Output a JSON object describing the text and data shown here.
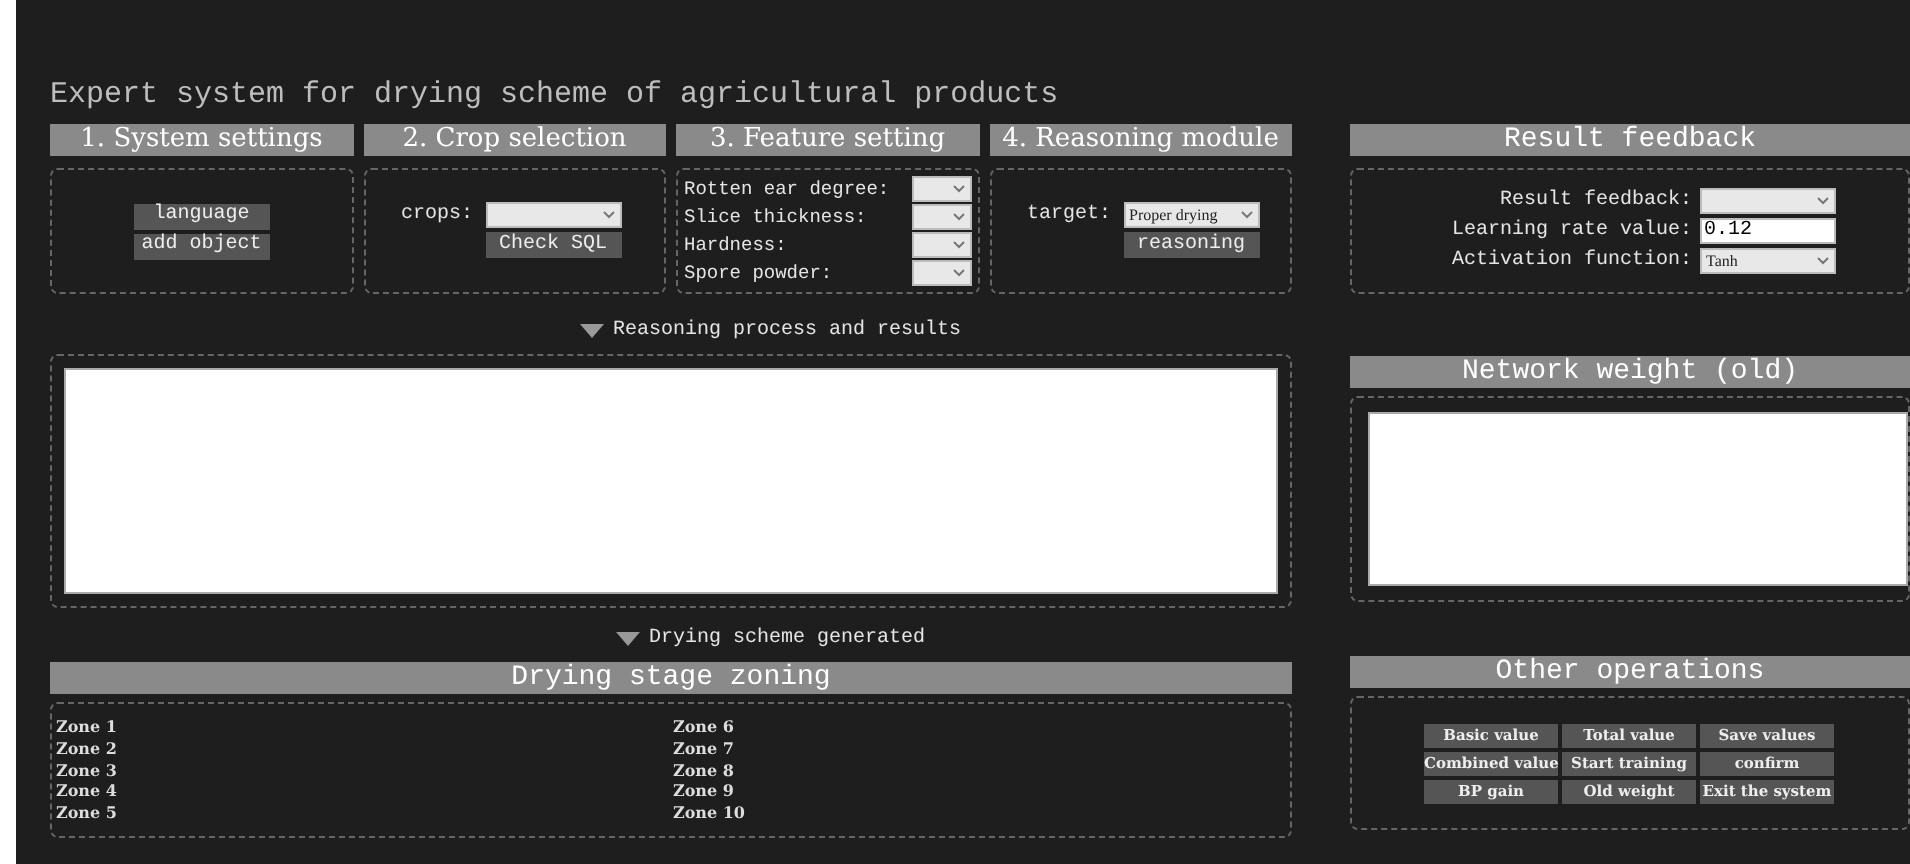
{
  "title": "Expert system for drying scheme of agricultural products",
  "modules": [
    {
      "heading": "1. System settings",
      "kind": "buttons",
      "buttons": [
        "language",
        "add object"
      ]
    },
    {
      "heading": "2. Crop selection",
      "kind": "crop",
      "label": "crops:",
      "button": "Check SQL"
    },
    {
      "heading": "3. Feature setting",
      "kind": "features",
      "fields": [
        {
          "label": "Rotten ear degree:"
        },
        {
          "label": "Slice thickness:"
        },
        {
          "label": "Hardness:"
        },
        {
          "label": "Spore powder:"
        }
      ]
    },
    {
      "heading": "4. Reasoning module",
      "kind": "crop",
      "label": "target:",
      "select": "Proper drying",
      "button": "reasoning"
    }
  ],
  "reasoning_toggle": {
    "label": "Reasoning process and results",
    "expanded": true
  },
  "scheme_toggle": {
    "label": "Drying scheme generated",
    "expanded": true
  },
  "zoning": {
    "heading": "Drying stage zoning",
    "zones": [
      "Zone 1",
      "Zone 2",
      "Zone 3",
      "Zone 4",
      "Zone 5",
      "Zone 6",
      "Zone 7",
      "Zone 8",
      "Zone 9",
      "Zone 10"
    ]
  },
  "result_feedback": {
    "heading": "Result feedback",
    "fields": [
      {
        "label": "Result feedback:",
        "kind": "select"
      },
      {
        "label": "Learning rate value:",
        "kind": "input",
        "value": "0.12"
      },
      {
        "label": "Activation function:",
        "kind": "select",
        "value": "Tanh"
      }
    ]
  },
  "network_weight": {
    "heading": "Network weight (old)"
  },
  "other_operations": {
    "heading": "Other operations",
    "buttons": [
      "Basic value",
      "Total value",
      "Save values",
      "Combined value",
      "Start training",
      "confirm",
      "BP gain",
      "Old weight",
      "Exit the system"
    ]
  }
}
